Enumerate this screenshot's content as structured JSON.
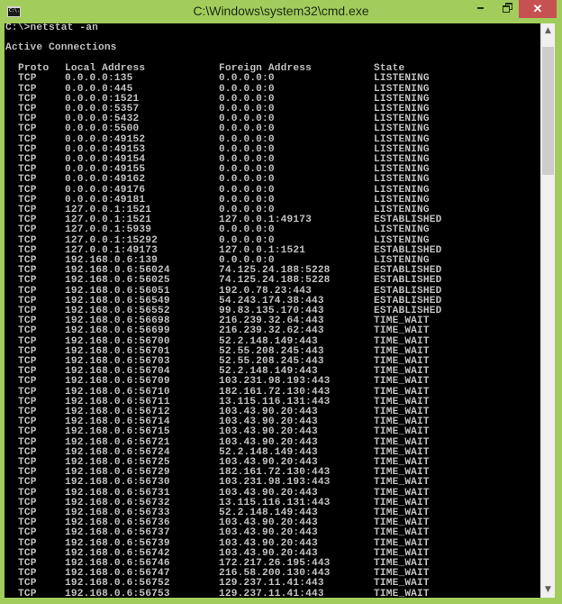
{
  "window": {
    "title": "C:\\Windows\\system32\\cmd.exe",
    "app_icon_text": "C:\\.",
    "buttons": {
      "minimize": "minimize",
      "maximize": "restore",
      "close": "✕"
    }
  },
  "console": {
    "prompt_line": "C:\\>netstat -an",
    "section_title": "Active Connections",
    "headers": {
      "proto": "Proto",
      "local": "Local Address",
      "foreign": "Foreign Address",
      "state": "State"
    },
    "rows": [
      {
        "proto": "TCP",
        "local": "0.0.0.0:135",
        "foreign": "0.0.0.0:0",
        "state": "LISTENING"
      },
      {
        "proto": "TCP",
        "local": "0.0.0.0:445",
        "foreign": "0.0.0.0:0",
        "state": "LISTENING"
      },
      {
        "proto": "TCP",
        "local": "0.0.0.0:1521",
        "foreign": "0.0.0.0:0",
        "state": "LISTENING"
      },
      {
        "proto": "TCP",
        "local": "0.0.0.0:5357",
        "foreign": "0.0.0.0:0",
        "state": "LISTENING"
      },
      {
        "proto": "TCP",
        "local": "0.0.0.0:5432",
        "foreign": "0.0.0.0:0",
        "state": "LISTENING"
      },
      {
        "proto": "TCP",
        "local": "0.0.0.0:5500",
        "foreign": "0.0.0.0:0",
        "state": "LISTENING"
      },
      {
        "proto": "TCP",
        "local": "0.0.0.0:49152",
        "foreign": "0.0.0.0:0",
        "state": "LISTENING"
      },
      {
        "proto": "TCP",
        "local": "0.0.0.0:49153",
        "foreign": "0.0.0.0:0",
        "state": "LISTENING"
      },
      {
        "proto": "TCP",
        "local": "0.0.0.0:49154",
        "foreign": "0.0.0.0:0",
        "state": "LISTENING"
      },
      {
        "proto": "TCP",
        "local": "0.0.0.0:49155",
        "foreign": "0.0.0.0:0",
        "state": "LISTENING"
      },
      {
        "proto": "TCP",
        "local": "0.0.0.0:49162",
        "foreign": "0.0.0.0:0",
        "state": "LISTENING"
      },
      {
        "proto": "TCP",
        "local": "0.0.0.0:49176",
        "foreign": "0.0.0.0:0",
        "state": "LISTENING"
      },
      {
        "proto": "TCP",
        "local": "0.0.0.0:49181",
        "foreign": "0.0.0.0:0",
        "state": "LISTENING"
      },
      {
        "proto": "TCP",
        "local": "127.0.0.1:1521",
        "foreign": "0.0.0.0:0",
        "state": "LISTENING"
      },
      {
        "proto": "TCP",
        "local": "127.0.0.1:1521",
        "foreign": "127.0.0.1:49173",
        "state": "ESTABLISHED"
      },
      {
        "proto": "TCP",
        "local": "127.0.0.1:5939",
        "foreign": "0.0.0.0:0",
        "state": "LISTENING"
      },
      {
        "proto": "TCP",
        "local": "127.0.0.1:15292",
        "foreign": "0.0.0.0:0",
        "state": "LISTENING"
      },
      {
        "proto": "TCP",
        "local": "127.0.0.1:49173",
        "foreign": "127.0.0.1:1521",
        "state": "ESTABLISHED"
      },
      {
        "proto": "TCP",
        "local": "192.168.0.6:139",
        "foreign": "0.0.0.0:0",
        "state": "LISTENING"
      },
      {
        "proto": "TCP",
        "local": "192.168.0.6:56024",
        "foreign": "74.125.24.188:5228",
        "state": "ESTABLISHED"
      },
      {
        "proto": "TCP",
        "local": "192.168.0.6:56025",
        "foreign": "74.125.24.188:5228",
        "state": "ESTABLISHED"
      },
      {
        "proto": "TCP",
        "local": "192.168.0.6:56051",
        "foreign": "192.0.78.23:443",
        "state": "ESTABLISHED"
      },
      {
        "proto": "TCP",
        "local": "192.168.0.6:56549",
        "foreign": "54.243.174.38:443",
        "state": "ESTABLISHED"
      },
      {
        "proto": "TCP",
        "local": "192.168.0.6:56552",
        "foreign": "99.83.135.170:443",
        "state": "ESTABLISHED"
      },
      {
        "proto": "TCP",
        "local": "192.168.0.6:56698",
        "foreign": "216.239.32.64:443",
        "state": "TIME_WAIT"
      },
      {
        "proto": "TCP",
        "local": "192.168.0.6:56699",
        "foreign": "216.239.32.62:443",
        "state": "TIME_WAIT"
      },
      {
        "proto": "TCP",
        "local": "192.168.0.6:56700",
        "foreign": "52.2.148.149:443",
        "state": "TIME_WAIT"
      },
      {
        "proto": "TCP",
        "local": "192.168.0.6:56701",
        "foreign": "52.55.208.245:443",
        "state": "TIME_WAIT"
      },
      {
        "proto": "TCP",
        "local": "192.168.0.6:56703",
        "foreign": "52.55.208.245:443",
        "state": "TIME_WAIT"
      },
      {
        "proto": "TCP",
        "local": "192.168.0.6:56704",
        "foreign": "52.2.148.149:443",
        "state": "TIME_WAIT"
      },
      {
        "proto": "TCP",
        "local": "192.168.0.6:56709",
        "foreign": "103.231.98.193:443",
        "state": "TIME_WAIT"
      },
      {
        "proto": "TCP",
        "local": "192.168.0.6:56710",
        "foreign": "182.161.72.130:443",
        "state": "TIME_WAIT"
      },
      {
        "proto": "TCP",
        "local": "192.168.0.6:56711",
        "foreign": "13.115.116.131:443",
        "state": "TIME_WAIT"
      },
      {
        "proto": "TCP",
        "local": "192.168.0.6:56712",
        "foreign": "103.43.90.20:443",
        "state": "TIME_WAIT"
      },
      {
        "proto": "TCP",
        "local": "192.168.0.6:56714",
        "foreign": "103.43.90.20:443",
        "state": "TIME_WAIT"
      },
      {
        "proto": "TCP",
        "local": "192.168.0.6:56715",
        "foreign": "103.43.90.20:443",
        "state": "TIME_WAIT"
      },
      {
        "proto": "TCP",
        "local": "192.168.0.6:56721",
        "foreign": "103.43.90.20:443",
        "state": "TIME_WAIT"
      },
      {
        "proto": "TCP",
        "local": "192.168.0.6:56724",
        "foreign": "52.2.148.149:443",
        "state": "TIME_WAIT"
      },
      {
        "proto": "TCP",
        "local": "192.168.0.6:56725",
        "foreign": "103.43.90.20:443",
        "state": "TIME_WAIT"
      },
      {
        "proto": "TCP",
        "local": "192.168.0.6:56729",
        "foreign": "182.161.72.130:443",
        "state": "TIME_WAIT"
      },
      {
        "proto": "TCP",
        "local": "192.168.0.6:56730",
        "foreign": "103.231.98.193:443",
        "state": "TIME_WAIT"
      },
      {
        "proto": "TCP",
        "local": "192.168.0.6:56731",
        "foreign": "103.43.90.20:443",
        "state": "TIME_WAIT"
      },
      {
        "proto": "TCP",
        "local": "192.168.0.6:56732",
        "foreign": "13.115.116.131:443",
        "state": "TIME_WAIT"
      },
      {
        "proto": "TCP",
        "local": "192.168.0.6:56733",
        "foreign": "52.2.148.149:443",
        "state": "TIME_WAIT"
      },
      {
        "proto": "TCP",
        "local": "192.168.0.6:56736",
        "foreign": "103.43.90.20:443",
        "state": "TIME_WAIT"
      },
      {
        "proto": "TCP",
        "local": "192.168.0.6:56737",
        "foreign": "103.43.90.20:443",
        "state": "TIME_WAIT"
      },
      {
        "proto": "TCP",
        "local": "192.168.0.6:56739",
        "foreign": "103.43.90.20:443",
        "state": "TIME_WAIT"
      },
      {
        "proto": "TCP",
        "local": "192.168.0.6:56742",
        "foreign": "103.43.90.20:443",
        "state": "TIME_WAIT"
      },
      {
        "proto": "TCP",
        "local": "192.168.0.6:56746",
        "foreign": "172.217.26.195:443",
        "state": "TIME_WAIT"
      },
      {
        "proto": "TCP",
        "local": "192.168.0.6:56747",
        "foreign": "216.58.200.130:443",
        "state": "TIME_WAIT"
      },
      {
        "proto": "TCP",
        "local": "192.168.0.6:56752",
        "foreign": "129.237.11.41:443",
        "state": "TIME_WAIT"
      },
      {
        "proto": "TCP",
        "local": "192.168.0.6:56753",
        "foreign": "129.237.11.41:443",
        "state": "TIME_WAIT"
      }
    ]
  },
  "scrollbar": {
    "up_arrow": "⌃",
    "down_arrow": "⌄"
  },
  "colors": {
    "frame": "#a2cd5d",
    "close_button": "#c75050",
    "console_bg": "#000000",
    "console_text": "#c0c0c0"
  }
}
